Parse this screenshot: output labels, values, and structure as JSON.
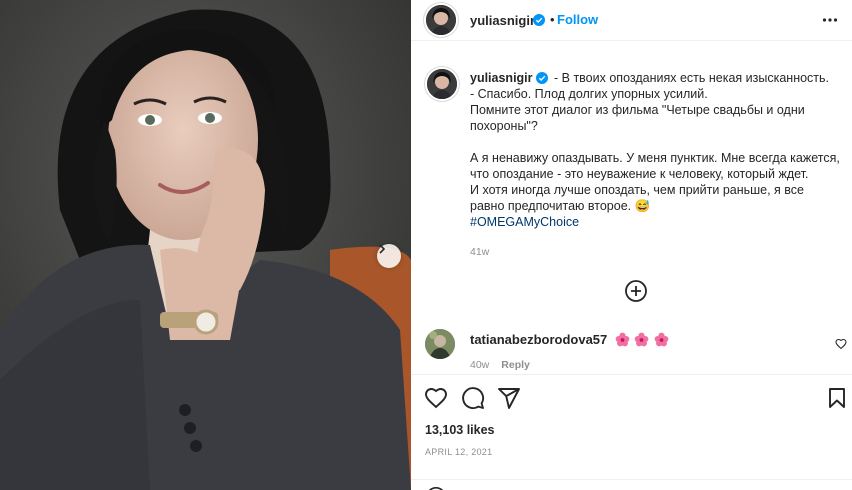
{
  "post": {
    "author": {
      "username": "yuliasnigir",
      "verified": true
    },
    "follow_label": "Follow",
    "separator": "•",
    "caption_lines": [
      "- В твоих опозданиях есть некая изысканность.",
      "- Спасибо. Плод долгих упорных усилий.",
      "Помните этот диалог из фильма \"Четыре свадьбы и одни похороны\"?"
    ],
    "caption_paragraph2": [
      "А я ненавижу опаздывать. У меня пунктик. Мне всегда кажется, что опоздание - это неуважение к человеку, который ждет.",
      "И хотя иногда лучше опоздать, чем прийти раньше, я все равно предпочитаю второе. 😅"
    ],
    "hashtag": "#OMEGAMyChoice",
    "time_ago": "41w",
    "likes": "13,103 likes",
    "date": "APRIL 12, 2021"
  },
  "comment": {
    "username": "tatianabezborodova57",
    "emoji_count": 3,
    "time_ago": "40w",
    "reply_label": "Reply"
  },
  "icons": {
    "verified": "verified-badge-icon",
    "more": "more-horizontal-icon",
    "load_more": "plus-circle-icon",
    "like": "heart-icon",
    "comment": "comment-bubble-icon",
    "share": "paper-plane-icon",
    "save": "bookmark-icon",
    "next": "chevron-right-icon",
    "emoji": "smiley-icon"
  },
  "colors": {
    "accent": "#0095f6",
    "verified": "#0095f6",
    "hashtag": "#00376b",
    "muted": "#8e8e8e",
    "text": "#262626"
  }
}
